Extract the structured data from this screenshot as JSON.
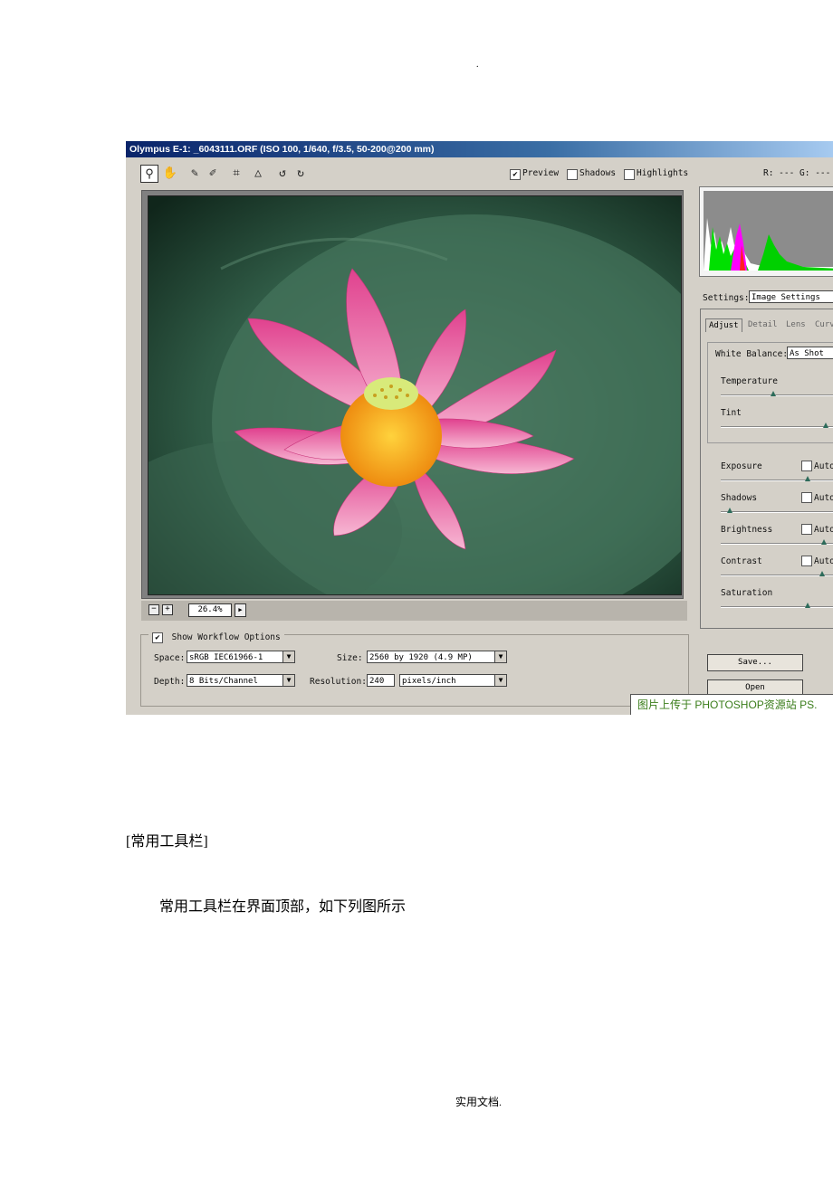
{
  "page": {
    "top_dot": ".",
    "footer": "实用文档."
  },
  "window": {
    "title": "Olympus E-1:  _6043111.ORF (ISO 100, 1/640, f/3.5, 50-200@200 mm)",
    "toolbar": {
      "preview_label": "Preview",
      "shadows_label": "Shadows",
      "highlights_label": "Highlights",
      "rgb_readout": "R: ---  G: ---  B:"
    },
    "zoom": {
      "value": "26.4%"
    },
    "workflow": {
      "legend": "Show Workflow Options",
      "space_label": "Space:",
      "space_value": "sRGB IEC61966-1",
      "size_label": "Size:",
      "size_value": "2560 by 1920  (4.9 MP)",
      "depth_label": "Depth:",
      "depth_value": "8 Bits/Channel",
      "resolution_label": "Resolution:",
      "resolution_value": "240",
      "resolution_unit": "pixels/inch"
    },
    "settings": {
      "label": "Settings:",
      "value": "Image Settings",
      "tabs": [
        "Adjust",
        "Detail",
        "Lens",
        "Curv"
      ],
      "white_balance_label": "White Balance:",
      "white_balance_value": "As Shot",
      "temperature_label": "Temperature",
      "tint_label": "Tint",
      "exposure_label": "Exposure",
      "shadows_label": "Shadows",
      "brightness_label": "Brightness",
      "contrast_label": "Contrast",
      "saturation_label": "Saturation",
      "auto_label": "Auto"
    },
    "buttons": {
      "save": "Save...",
      "open": "Open"
    },
    "watermark": "图片上传于 PHOTOSHOP资源站  PS."
  },
  "document": {
    "section_heading": "[常用工具栏]",
    "paragraph": "常用工具栏在界面顶部，如下列图所示"
  }
}
